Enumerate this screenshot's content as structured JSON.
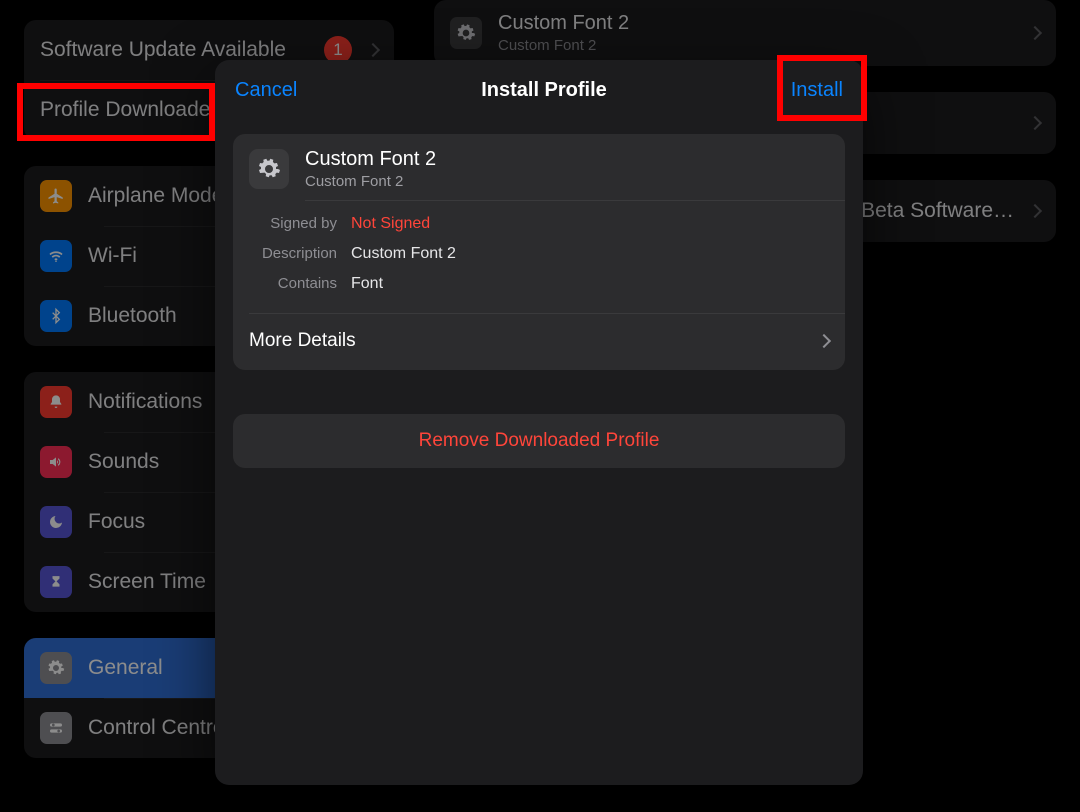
{
  "sidebar": {
    "top": [
      {
        "label": "Software Update Available",
        "badge": "1"
      },
      {
        "label": "Profile Downloaded"
      }
    ],
    "net": [
      {
        "label": "Airplane Mode"
      },
      {
        "label": "Wi-Fi"
      },
      {
        "label": "Bluetooth"
      }
    ],
    "alerts": [
      {
        "label": "Notifications"
      },
      {
        "label": "Sounds"
      },
      {
        "label": "Focus"
      },
      {
        "label": "Screen Time"
      }
    ],
    "sys": [
      {
        "label": "General"
      },
      {
        "label": "Control Centre"
      }
    ]
  },
  "rightpane": {
    "profile": {
      "title": "Custom Font 2",
      "subtitle": "Custom Font 2"
    },
    "beta_label": "Beta Software…"
  },
  "modal": {
    "cancel": "Cancel",
    "title": "Install Profile",
    "install": "Install",
    "profile": {
      "title": "Custom Font 2",
      "subtitle": "Custom Font 2",
      "signed_label": "Signed by",
      "signed_value": "Not Signed",
      "description_label": "Description",
      "description_value": "Custom Font 2",
      "contains_label": "Contains",
      "contains_value": "Font",
      "more": "More Details"
    },
    "remove": "Remove Downloaded Profile"
  }
}
